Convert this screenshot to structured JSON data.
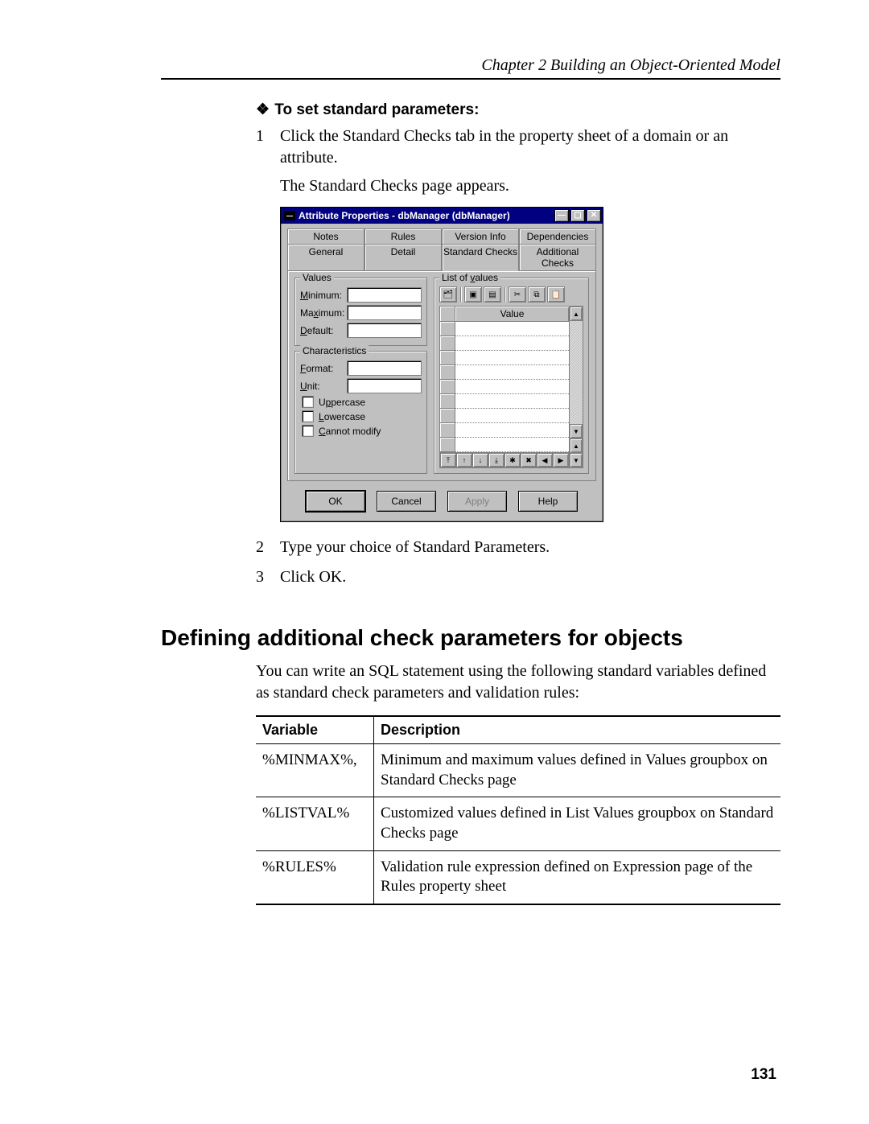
{
  "header": {
    "running": "Chapter 2  Building an Object-Oriented Model"
  },
  "task": {
    "title": "To set standard parameters:",
    "steps": [
      "Click the Standard Checks tab in the property sheet of a domain or an attribute.",
      "Type your choice of Standard Parameters.",
      "Click OK."
    ],
    "result": "The Standard Checks page appears."
  },
  "dialog": {
    "title": "Attribute Properties - dbManager (dbManager)",
    "tabs_top": [
      "Notes",
      "Rules",
      "Version Info",
      "Dependencies"
    ],
    "tabs_bottom": [
      "General",
      "Detail",
      "Standard Checks",
      "Additional Checks"
    ],
    "active_tab": "Standard Checks",
    "values_group": {
      "legend": "Values",
      "minimum": "Minimum:",
      "maximum": "Maximum:",
      "default": "Default:"
    },
    "characteristics_group": {
      "legend": "Characteristics",
      "format": "Format:",
      "unit": "Unit:",
      "uppercase": "Uppercase",
      "lowercase": "Lowercase",
      "cannot_modify": "Cannot modify"
    },
    "list_group": {
      "legend": "List of values",
      "col_header": "Value"
    },
    "buttons": {
      "ok": "OK",
      "cancel": "Cancel",
      "apply": "Apply",
      "help": "Help"
    }
  },
  "section": {
    "heading": "Defining additional check parameters for objects",
    "intro": "You can write an SQL statement using the following standard variables defined as standard check parameters and validation rules:",
    "table": {
      "headers": [
        "Variable",
        "Description"
      ],
      "rows": [
        {
          "var": "%MINMAX%,",
          "desc": "Minimum and maximum values defined in Values groupbox on Standard Checks page"
        },
        {
          "var": "%LISTVAL%",
          "desc": "Customized values defined in List Values groupbox on Standard Checks page"
        },
        {
          "var": "%RULES%",
          "desc": "Validation rule expression defined on Expression page of the Rules property sheet"
        }
      ]
    }
  },
  "page_number": "131"
}
